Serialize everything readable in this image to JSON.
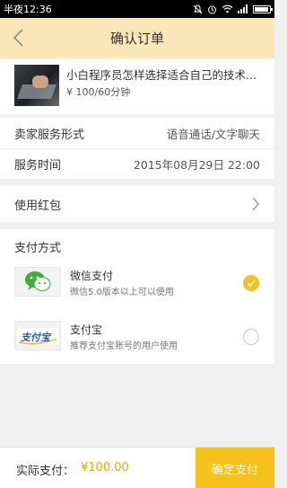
{
  "status_bar": {
    "time": "半夜12:36"
  },
  "header": {
    "title": "确认订单"
  },
  "product": {
    "name": "小白程序员怎样选择适合自己的技术...",
    "price": "¥ 100/60分钟"
  },
  "details": [
    {
      "label": "卖家服务形式",
      "value": "语音通话/文字聊天"
    },
    {
      "label": "服务时间",
      "value": "2015年08月29日 22:00"
    }
  ],
  "red_packet": {
    "label": "使用红包"
  },
  "payment": {
    "header": "支付方式",
    "options": [
      {
        "name": "微信支付",
        "desc": "微信5.0版本以上可以使用",
        "selected": true
      },
      {
        "name": "支付宝",
        "desc": "推荐支付宝账号的用户使用",
        "selected": false,
        "logo_text": "支付宝"
      }
    ]
  },
  "footer": {
    "label": "实际支付：",
    "amount": "¥100.00",
    "confirm": "确定支付"
  },
  "colors": {
    "accent": "#f5c11a",
    "header_bg": "#f9e7b9",
    "amount": "#e9a700",
    "wechat": "#3cb034",
    "alipay": "#1d5aa8"
  }
}
